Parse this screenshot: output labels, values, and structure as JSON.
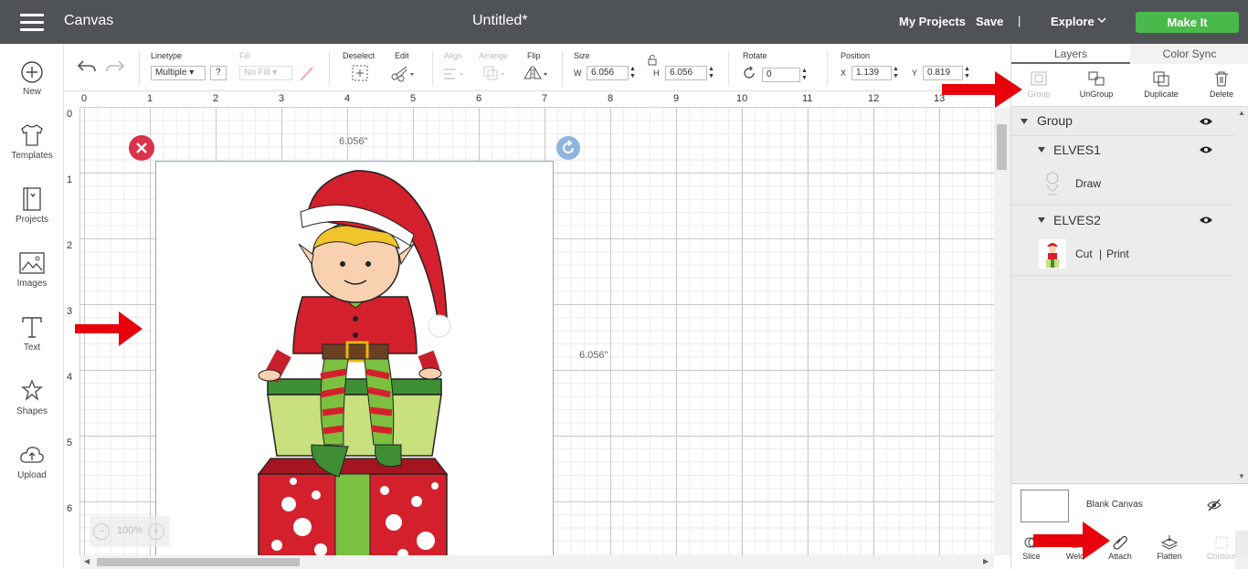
{
  "topbar": {
    "app_title": "Canvas",
    "doc_title": "Untitled*",
    "my_projects": "My Projects",
    "save": "Save",
    "separator": "|",
    "explore": "Explore",
    "make_it": "Make It"
  },
  "sidebar": {
    "items": [
      {
        "label": "New",
        "icon": "plus-circle-icon"
      },
      {
        "label": "Templates",
        "icon": "shirt-icon"
      },
      {
        "label": "Projects",
        "icon": "book-icon"
      },
      {
        "label": "Images",
        "icon": "image-icon"
      },
      {
        "label": "Text",
        "icon": "text-icon"
      },
      {
        "label": "Shapes",
        "icon": "shapes-icon"
      },
      {
        "label": "Upload",
        "icon": "cloud-upload-icon"
      }
    ]
  },
  "toolbar": {
    "linetype_label": "Linetype",
    "linetype_value": "Multiple",
    "help": "?",
    "fill_label": "Fill",
    "fill_value": "No Fill",
    "deselect_label": "Deselect",
    "edit_label": "Edit",
    "align_label": "Align",
    "arrange_label": "Arrange",
    "flip_label": "Flip",
    "size_label": "Size",
    "w_label": "W",
    "w_value": "6.056",
    "h_label": "H",
    "h_value": "6.056",
    "rotate_label": "Rotate",
    "rotate_value": "0",
    "position_label": "Position",
    "x_label": "X",
    "x_value": "1.139",
    "y_label": "Y",
    "y_value": "0.819"
  },
  "canvas": {
    "ruler_h": [
      "0",
      "1",
      "2",
      "3",
      "4",
      "5",
      "6",
      "7",
      "8",
      "9",
      "10",
      "11",
      "12",
      "13"
    ],
    "ruler_v": [
      "0",
      "1",
      "2",
      "3",
      "4",
      "5",
      "6"
    ],
    "width_label": "6.056\"",
    "height_label": "6.056\"",
    "zoom_value": "100%",
    "zoom_minus": "−",
    "zoom_plus": "+"
  },
  "panel": {
    "tabs": [
      "Layers",
      "Color Sync"
    ],
    "actions": [
      {
        "label": "Group",
        "enabled": false
      },
      {
        "label": "UnGroup",
        "enabled": true
      },
      {
        "label": "Duplicate",
        "enabled": true
      },
      {
        "label": "Delete",
        "enabled": true
      }
    ],
    "layers": {
      "group_name": "Group",
      "elves1_name": "ELVES1",
      "elves1_op": "Draw",
      "elves2_name": "ELVES2",
      "elves2_op_cut": "Cut",
      "elves2_op_sep": "|",
      "elves2_op_print": "Print"
    },
    "blank_canvas": "Blank Canvas",
    "bottom_actions": [
      {
        "label": "Slice",
        "enabled": true
      },
      {
        "label": "Weld",
        "enabled": true
      },
      {
        "label": "Attach",
        "enabled": true
      },
      {
        "label": "Flatten",
        "enabled": true
      },
      {
        "label": "Contour",
        "enabled": false
      }
    ]
  },
  "colors": {
    "topbar": "#4f5356",
    "make_it": "#49b94b",
    "close_handle": "#d9324a",
    "rotate_handle": "#8fb4dd",
    "annotation_arrow": "#e8000b"
  }
}
